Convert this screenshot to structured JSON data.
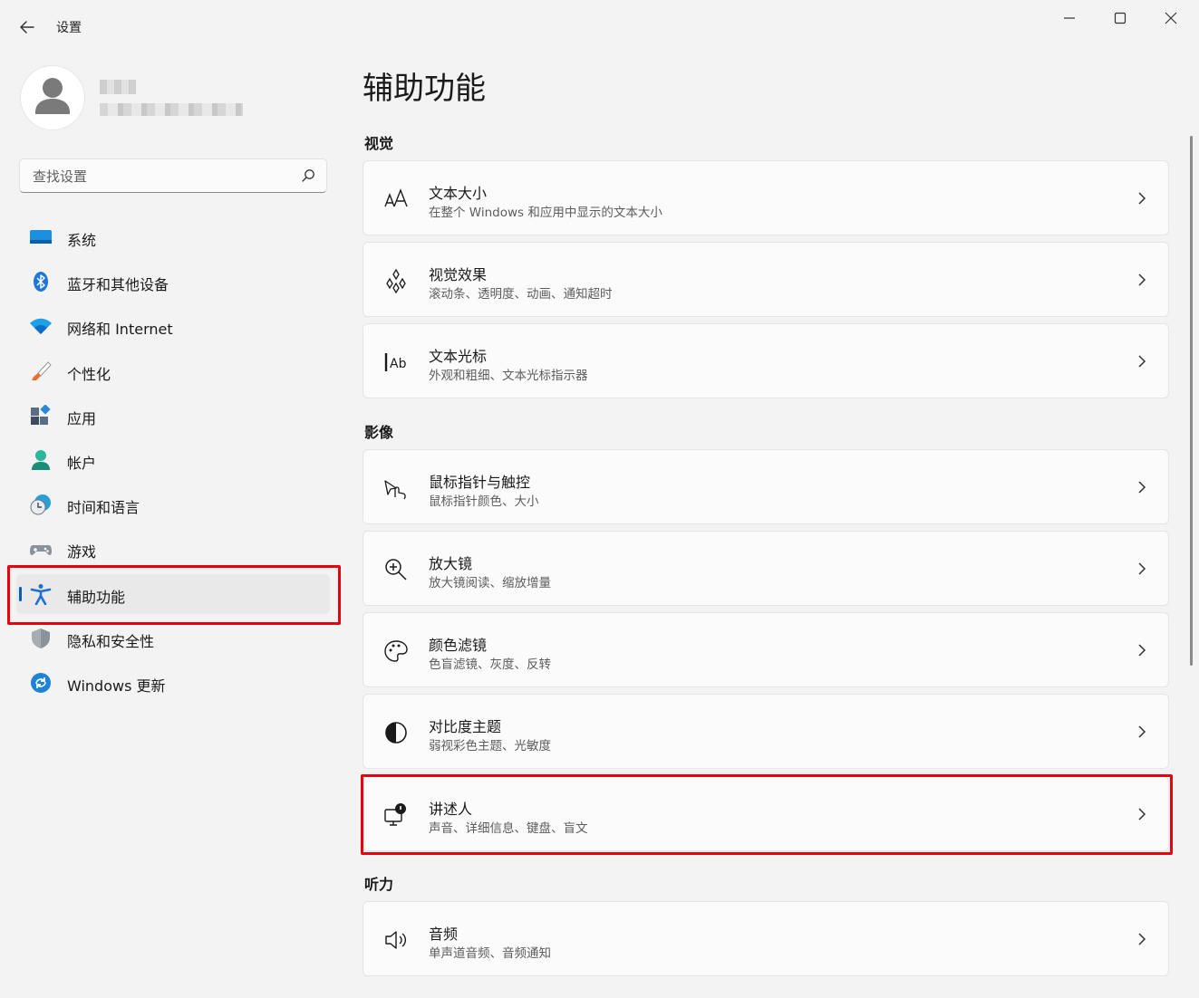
{
  "window": {
    "title": "设置"
  },
  "search": {
    "placeholder": "查找设置"
  },
  "nav": {
    "items": [
      {
        "label": "系统"
      },
      {
        "label": "蓝牙和其他设备"
      },
      {
        "label": "网络和 Internet"
      },
      {
        "label": "个性化"
      },
      {
        "label": "应用"
      },
      {
        "label": "帐户"
      },
      {
        "label": "时间和语言"
      },
      {
        "label": "游戏"
      },
      {
        "label": "辅助功能",
        "selected": true
      },
      {
        "label": "隐私和安全性"
      },
      {
        "label": "Windows 更新"
      }
    ]
  },
  "page": {
    "title": "辅助功能",
    "sections": [
      {
        "title": "视觉"
      },
      {
        "title": "影像"
      },
      {
        "title": "听力"
      }
    ],
    "cards": [
      {
        "title": "文本大小",
        "subtitle": "在整个 Windows 和应用中显示的文本大小",
        "icon": "text-size-icon"
      },
      {
        "title": "视觉效果",
        "subtitle": "滚动条、透明度、动画、通知超时",
        "icon": "visual-effects-icon"
      },
      {
        "title": "文本光标",
        "subtitle": "外观和粗细、文本光标指示器",
        "icon": "text-cursor-icon"
      },
      {
        "title": "鼠标指针与触控",
        "subtitle": "鼠标指针颜色、大小",
        "icon": "mouse-pointer-icon"
      },
      {
        "title": "放大镜",
        "subtitle": "放大镜阅读、缩放增量",
        "icon": "magnifier-icon"
      },
      {
        "title": "颜色滤镜",
        "subtitle": "色盲滤镜、灰度、反转",
        "icon": "color-filter-icon"
      },
      {
        "title": "对比度主题",
        "subtitle": "弱视彩色主题、光敏度",
        "icon": "contrast-icon"
      },
      {
        "title": "讲述人",
        "subtitle": "声音、详细信息、键盘、盲文",
        "icon": "narrator-icon"
      },
      {
        "title": "音频",
        "subtitle": "单声道音频、音频通知",
        "icon": "audio-icon"
      }
    ]
  },
  "colors": {
    "accent": "#005fb8",
    "highlight": "#e8000d",
    "background": "#f3f3f3",
    "card": "#fbfbfb"
  }
}
